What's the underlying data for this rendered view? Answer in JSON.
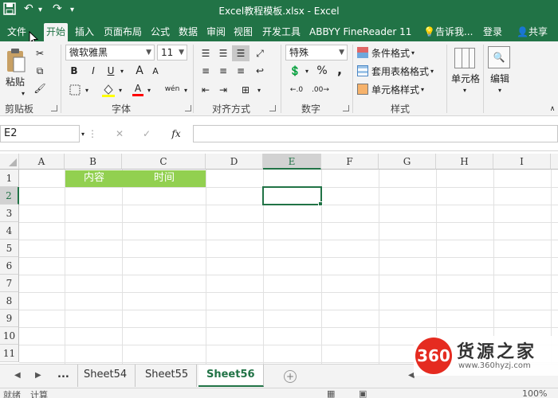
{
  "window": {
    "title": "Excel教程模板.xlsx - Excel"
  },
  "ribbon_tabs": [
    {
      "label": "文件"
    },
    {
      "label": "开始"
    },
    {
      "label": "插入"
    },
    {
      "label": "页面布局"
    },
    {
      "label": "公式"
    },
    {
      "label": "数据"
    },
    {
      "label": "审阅"
    },
    {
      "label": "视图"
    },
    {
      "label": "开发工具"
    },
    {
      "label": "ABBYY FineReader 11"
    }
  ],
  "tell_me": "告诉我...",
  "signin": "登录",
  "share": "共享",
  "ribbon": {
    "paste_label": "粘贴",
    "clipboard_group": "剪贴板",
    "font_name": "微软雅黑",
    "font_size": "11",
    "font_group": "字体",
    "bold": "B",
    "italic": "I",
    "underline": "U",
    "font_color": "A",
    "grow_font": "A",
    "shrink_font": "A",
    "phonetic": "wén",
    "align_group": "对齐方式",
    "number_format": "特殊",
    "number_group": "数字",
    "percent": "%",
    "comma": ",",
    "cond_format": "条件格式",
    "table_format": "套用表格格式",
    "cell_style": "单元格样式",
    "styles_group": "样式",
    "cells_label": "单元格",
    "edit_label": "编辑"
  },
  "formula_bar": {
    "name_box": "E2",
    "cancel": "✕",
    "confirm": "✓",
    "fx": "fx",
    "value": ""
  },
  "columns": [
    "A",
    "B",
    "C",
    "D",
    "E",
    "F",
    "G",
    "H",
    "I"
  ],
  "rows": [
    "1",
    "2",
    "3",
    "4",
    "5",
    "6",
    "7",
    "8",
    "9",
    "10",
    "11"
  ],
  "selected_cell": "E2",
  "cells": {
    "B1": "内容",
    "C1": "时间"
  },
  "header_fill": "#92d050",
  "sheet_tabs": [
    {
      "label": "Sheet54"
    },
    {
      "label": "Sheet55"
    },
    {
      "label": "Sheet56",
      "active": true
    }
  ],
  "sheet_more": "...",
  "status": {
    "ready": "就绪",
    "calc": "计算",
    "zoom": "100%"
  },
  "watermark": {
    "badge": "360",
    "name": "货源之家",
    "url": "www.360hyzj.com"
  },
  "colors": {
    "accent": "#217346",
    "header_fill": "#92d050"
  }
}
